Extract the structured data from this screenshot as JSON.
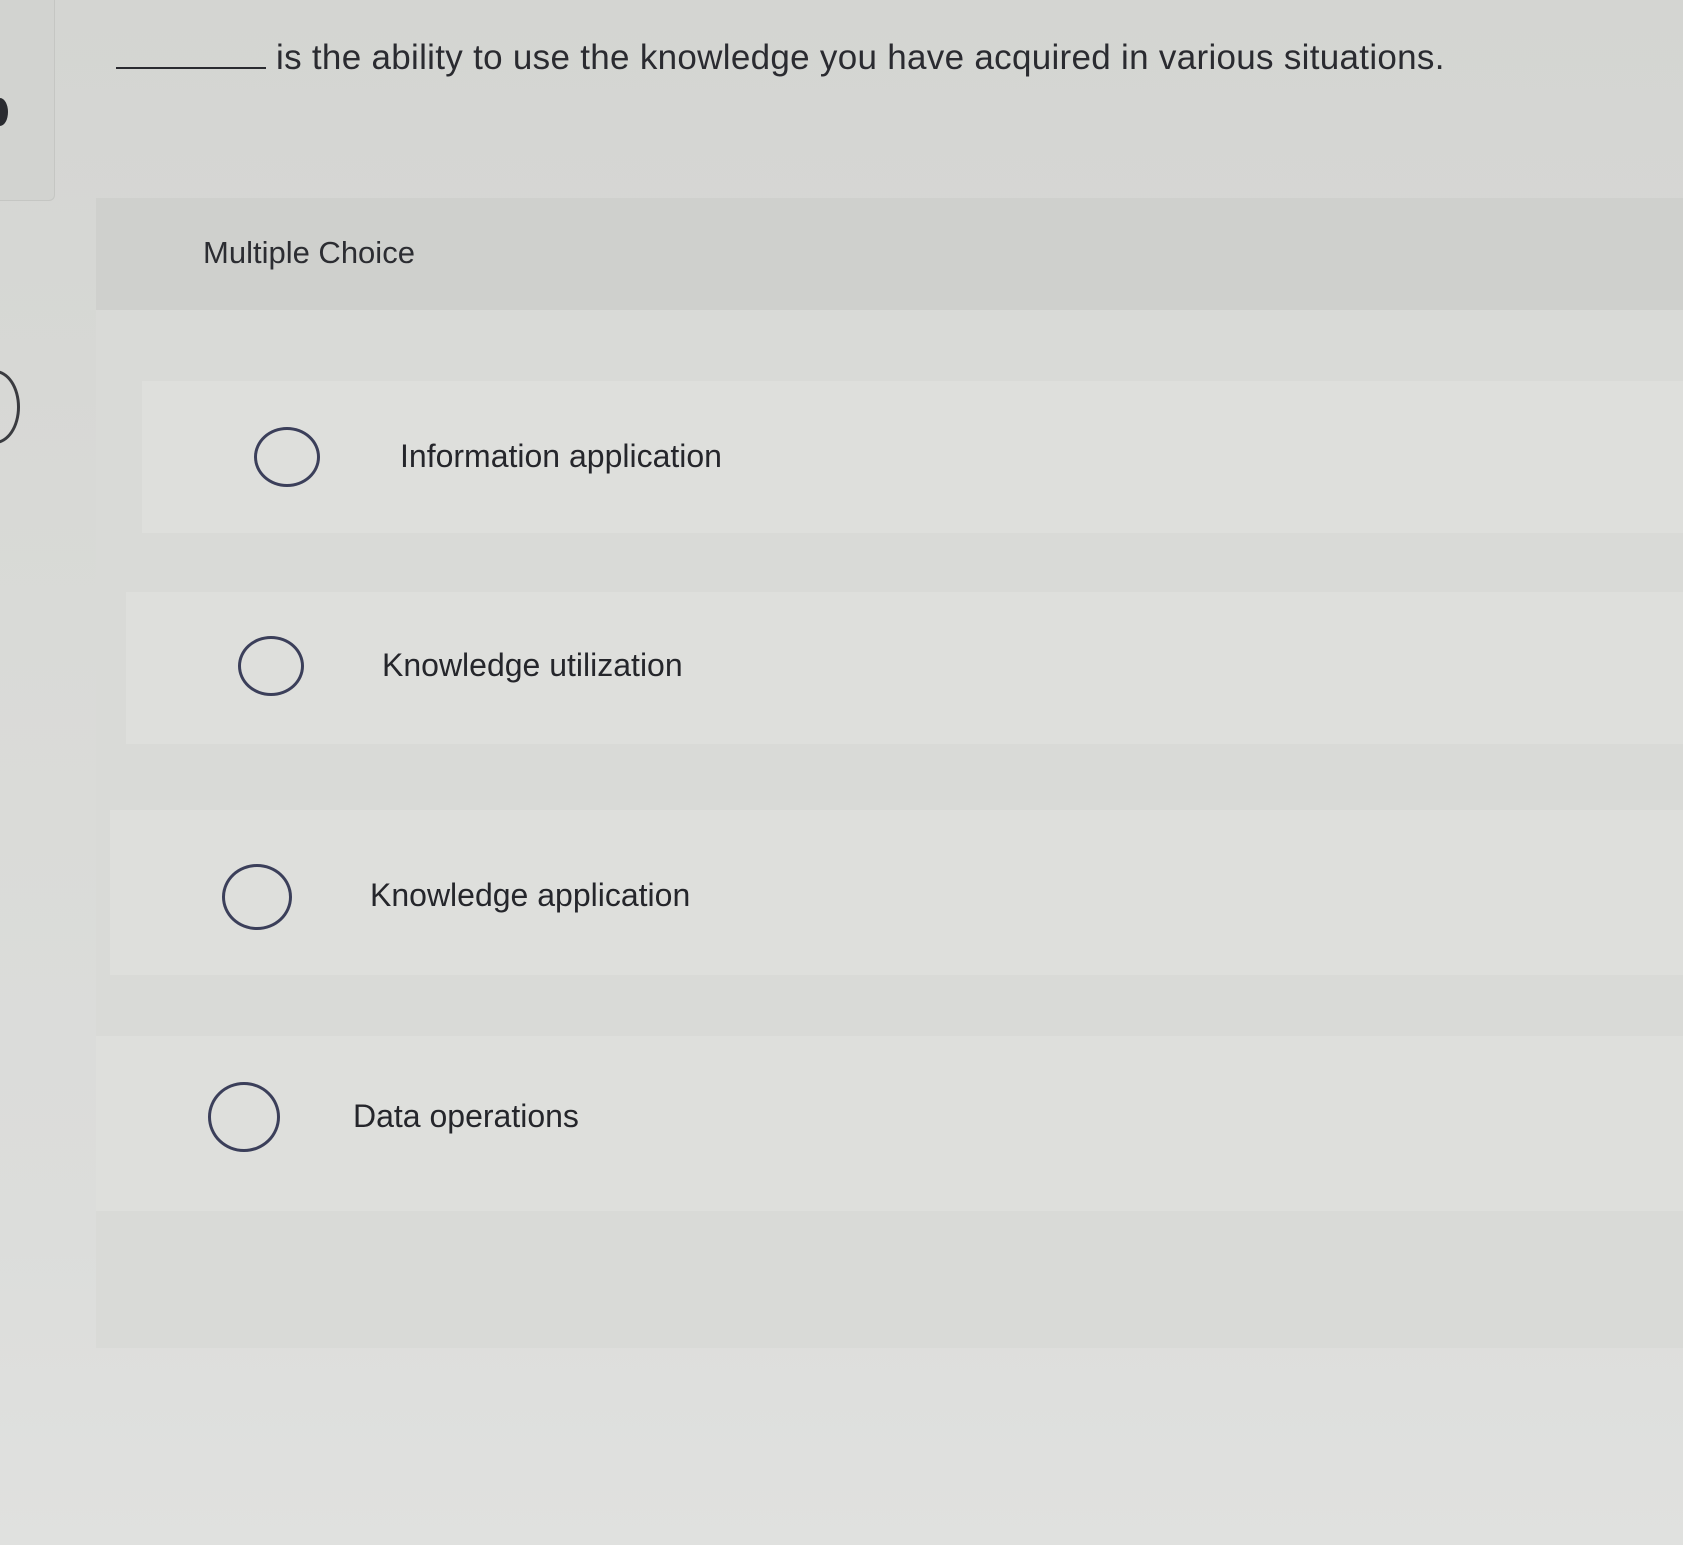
{
  "question": {
    "text": "is the ability to use the knowledge you have acquired in various situations."
  },
  "section": {
    "label": "Multiple Choice"
  },
  "options": [
    {
      "label": "Information application",
      "selected": false
    },
    {
      "label": "Knowledge utilization",
      "selected": false
    },
    {
      "label": "Knowledge application",
      "selected": false
    },
    {
      "label": "Data operations",
      "selected": false
    }
  ]
}
